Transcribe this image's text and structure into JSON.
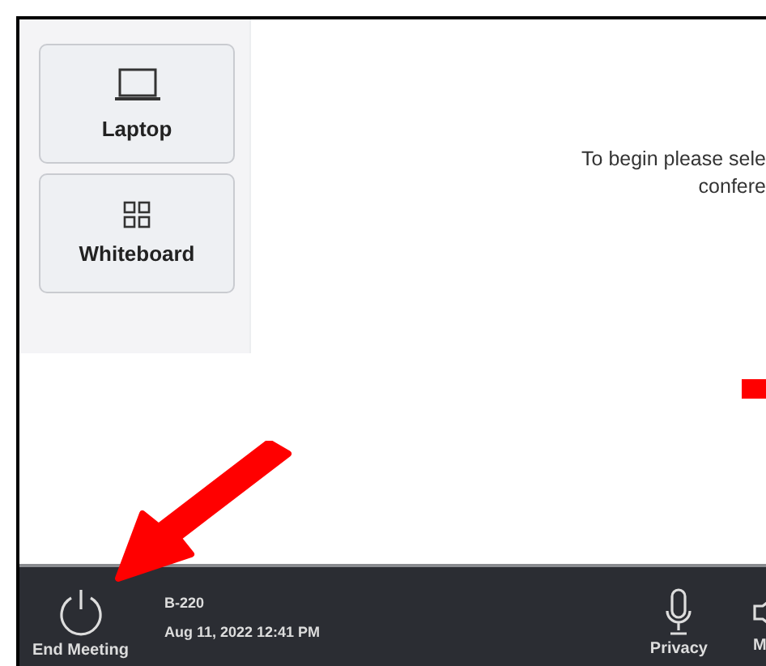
{
  "sources": [
    {
      "kind": "laptop",
      "label": "Laptop"
    },
    {
      "kind": "whiteboard",
      "label": "Whiteboard"
    }
  ],
  "prompt": {
    "lines": [
      "To begin please sele",
      "confere"
    ]
  },
  "footer": {
    "end_button": "End Meeting",
    "room": "B-220",
    "datetime": "Aug 11, 2022 12:41 PM",
    "controls": [
      {
        "kind": "mic",
        "label": "Privacy"
      },
      {
        "kind": "speaker",
        "label": "M"
      }
    ]
  }
}
